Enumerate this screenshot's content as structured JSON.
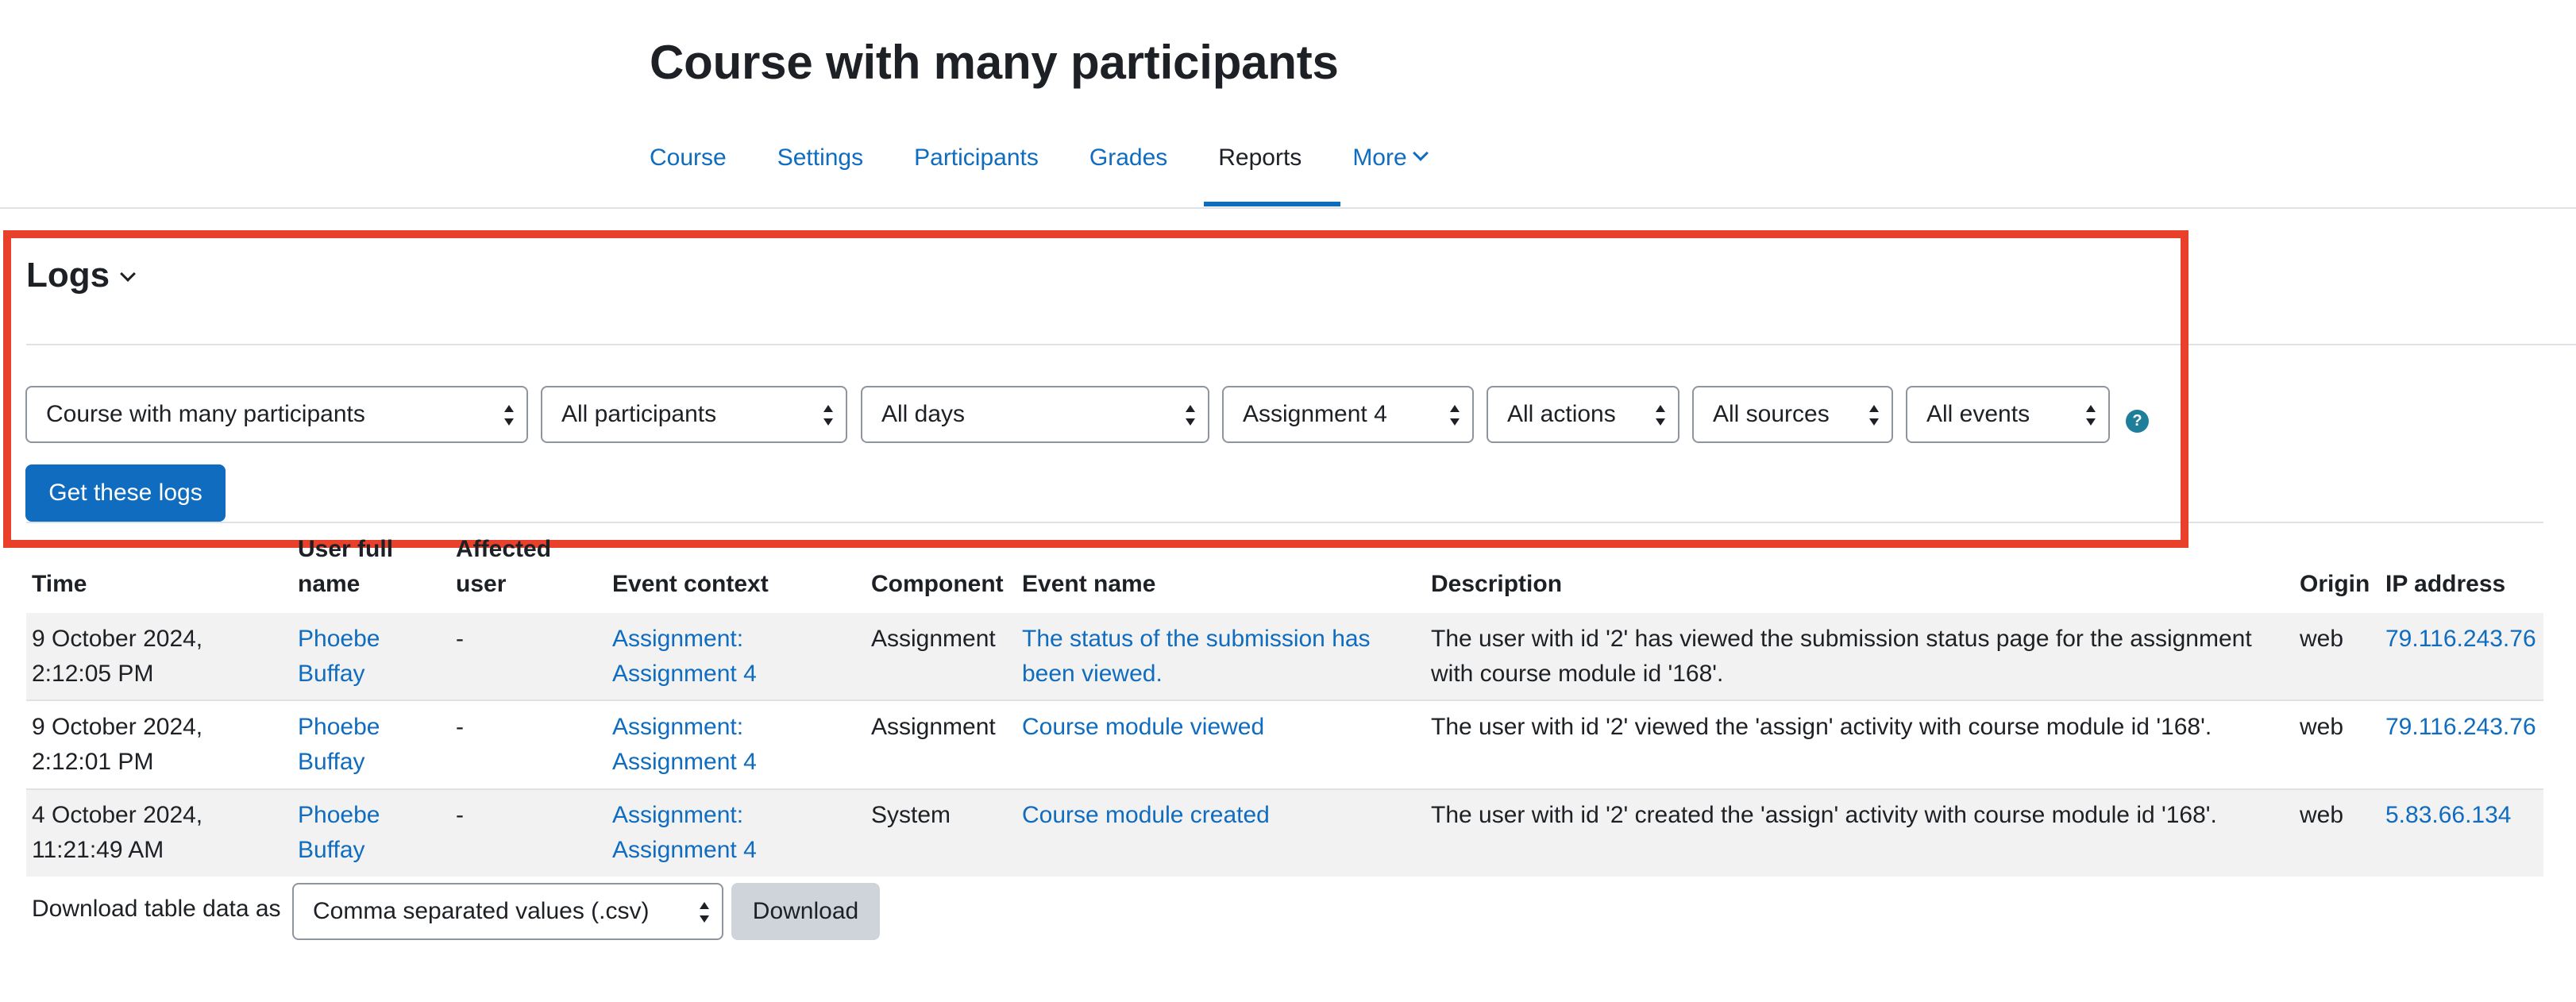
{
  "page": {
    "title": "Course with many participants"
  },
  "nav": {
    "items": [
      {
        "label": "Course"
      },
      {
        "label": "Settings"
      },
      {
        "label": "Participants"
      },
      {
        "label": "Grades"
      },
      {
        "label": "Reports"
      },
      {
        "label": "More"
      }
    ],
    "active": "Reports"
  },
  "logs": {
    "heading": "Logs",
    "filters": {
      "course": "Course with many participants",
      "participants": "All participants",
      "days": "All days",
      "activity": "Assignment 4",
      "actions": "All actions",
      "sources": "All sources",
      "events": "All events"
    },
    "help_icon": "question-icon",
    "get_logs_label": "Get these logs"
  },
  "table": {
    "headers": {
      "time": "Time",
      "user_full_name_1": "User full",
      "user_full_name_2": "name",
      "affected_user_1": "Affected",
      "affected_user_2": "user",
      "event_context": "Event context",
      "component": "Component",
      "event_name": "Event name",
      "description": "Description",
      "origin": "Origin",
      "ip_address": "IP address"
    },
    "rows": [
      {
        "time_1": "9 October 2024,",
        "time_2": "2:12:05 PM",
        "user_1": "Phoebe",
        "user_2": "Buffay",
        "affected": "-",
        "context_1": "Assignment:",
        "context_2": "Assignment 4",
        "component": "Assignment",
        "event_1": "The status of the submission has",
        "event_2": "been viewed.",
        "desc_1": "The user with id '2' has viewed the submission status page for the assignment",
        "desc_2": "with course module id '168'.",
        "origin": "web",
        "ip": "79.116.243.76"
      },
      {
        "time_1": "9 October 2024,",
        "time_2": "2:12:01 PM",
        "user_1": "Phoebe",
        "user_2": "Buffay",
        "affected": "-",
        "context_1": "Assignment:",
        "context_2": "Assignment 4",
        "component": "Assignment",
        "event_1": "Course module viewed",
        "event_2": "",
        "desc_1": "The user with id '2' viewed the 'assign' activity with course module id '168'.",
        "desc_2": "",
        "origin": "web",
        "ip": "79.116.243.76"
      },
      {
        "time_1": "4 October 2024,",
        "time_2": "11:21:49 AM",
        "user_1": "Phoebe",
        "user_2": "Buffay",
        "affected": "-",
        "context_1": "Assignment:",
        "context_2": "Assignment 4",
        "component": "System",
        "event_1": "Course module created",
        "event_2": "",
        "desc_1": "The user with id '2' created the 'assign' activity with course module id '168'.",
        "desc_2": "",
        "origin": "web",
        "ip": "5.83.66.134"
      }
    ]
  },
  "download": {
    "label": "Download table data as",
    "format": "Comma separated values (.csv)",
    "button": "Download"
  },
  "colors": {
    "link": "#0f6cbf",
    "highlight": "#e8402a",
    "help_icon": "#1f7e9a"
  }
}
